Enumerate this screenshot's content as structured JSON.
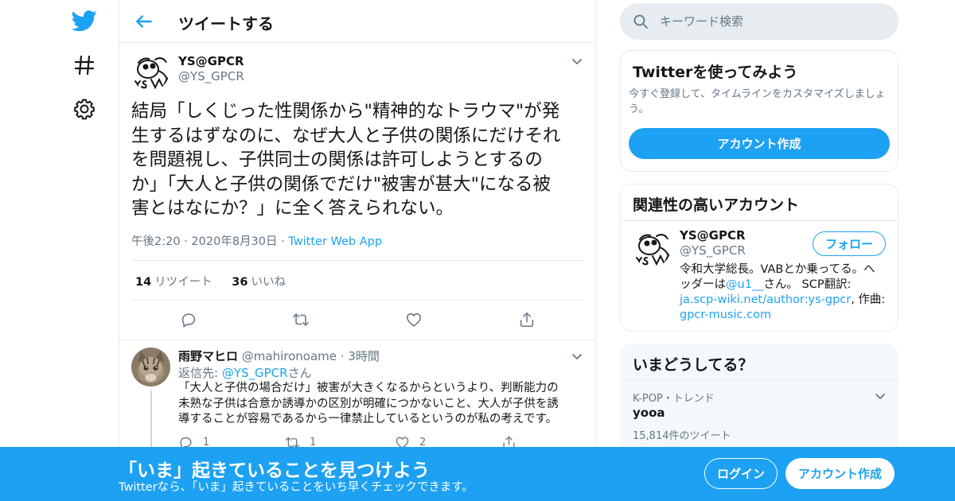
{
  "colors": {
    "accent": "#1da1f2",
    "text": "#14171a",
    "secondary": "#657786",
    "border": "#e6ecf0"
  },
  "nav": {
    "icons": [
      "twitter-bird-icon",
      "hashtag-icon",
      "gear-icon"
    ]
  },
  "header": {
    "title": "ツイートする"
  },
  "tweet": {
    "author_name": "YS@GPCR",
    "author_handle": "@YS_GPCR",
    "text_lines": [
      "結局「しくじった性関係から\"精神的なトラウマ\"が発",
      "生するはずなのに、なぜ大人と子供の関係にだけそれ",
      "を問題視し、子供同士の関係は許可しようとするの",
      "か」「大人と子供の関係でだけ\"被害が甚大\"になる被",
      "害とはなにか？」に全く答えられない。"
    ],
    "time": "午後2:20",
    "date": "2020年8月30日",
    "source": "Twitter Web App",
    "retweet_count": "14",
    "retweet_label": "リツイート",
    "like_count": "36",
    "like_label": "いいね"
  },
  "reply": {
    "author_name": "雨野マヒロ",
    "author_handle": "@mahironoame",
    "time": "3時間",
    "replying_prefix": "返信先: ",
    "replying_to": "@YS_GPCR",
    "replying_suffix": "さん",
    "text_lines": [
      "「大人と子供の場合だけ」被害が大きくなるからというより、判断能力の",
      "未熟な子供は合意か誘導かの区別が明確につかないこと、大人が子供を誘",
      "導することが容易であるから一律禁止しているというのが私の考えです。"
    ],
    "reply_count": "1",
    "retweet_count": "1",
    "like_count": "2"
  },
  "search": {
    "placeholder": "キーワード検索"
  },
  "signup_card": {
    "title": "Twitterを使ってみよう",
    "desc_lines": [
      "今すぐ登録して、タイムラインをカスタマイズしましょ",
      "う。"
    ],
    "button": "アカウント作成"
  },
  "related_card": {
    "title": "関連性の高いアカウント",
    "name": "YS@GPCR",
    "handle": "@YS_GPCR",
    "follow_button": "フォロー",
    "bio_line1": "令和大学総長。VABとか乗ってる。へ",
    "bio_line2_prefix": "ッダーは",
    "bio_line2_link": "@u1__",
    "bio_line2_suffix": "さん。 SCP翻訳:",
    "bio_link1": "ja.scp-wiki.net/author:ys-gpcr",
    "bio_line3_suffix": ", 作曲:",
    "bio_link2": "gpcr-music.com"
  },
  "trends_card": {
    "title": "いまどうしてる？",
    "trend_category": "K-POP・トレンド",
    "trend_name": "yooa",
    "trend_count": "15,814件のツイート"
  },
  "banner": {
    "title": "「いま」起きていることを見つけよう",
    "subtitle": "Twitterなら、「いま」起きていることをいち早くチェックできます。",
    "login": "ログイン",
    "signup": "アカウント作成"
  }
}
